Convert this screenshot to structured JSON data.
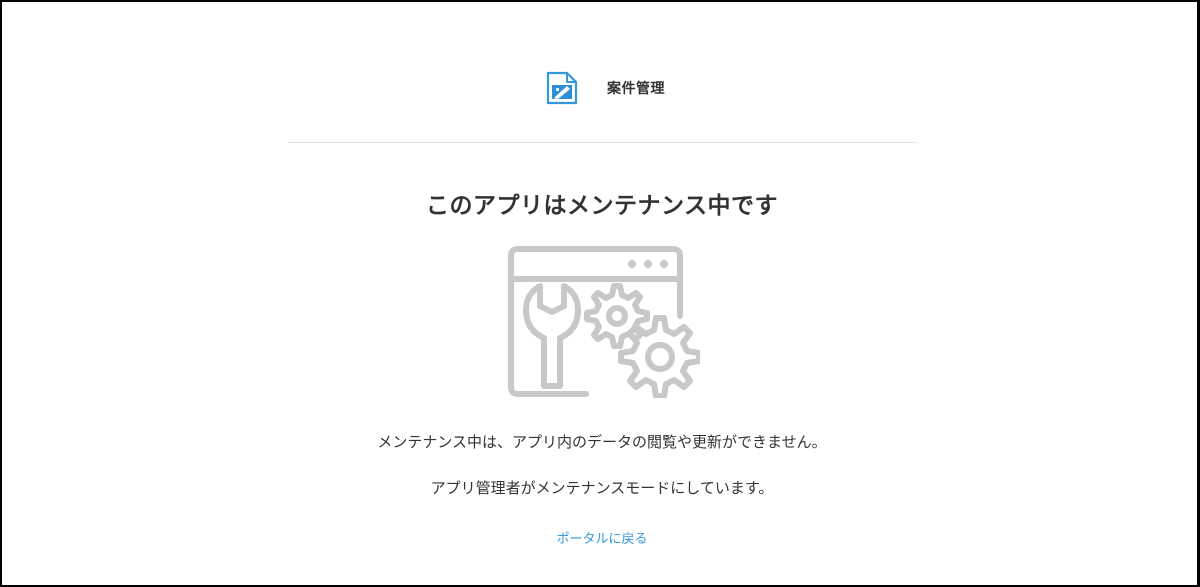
{
  "app": {
    "name": "案件管理",
    "icon": "edit-document-icon",
    "icon_color": "#3498db"
  },
  "maintenance": {
    "title": "このアプリはメンテナンス中です",
    "illustration": "maintenance-window-wrench-gears-icon",
    "illustration_color": "#c8c8c8",
    "message_line1": "メンテナンス中は、アプリ内のデータの閲覧や更新ができません。",
    "message_line2": "アプリ管理者がメンテナンスモードにしています。"
  },
  "links": {
    "back_to_portal": "ポータルに戻る",
    "link_color": "#3498db"
  }
}
